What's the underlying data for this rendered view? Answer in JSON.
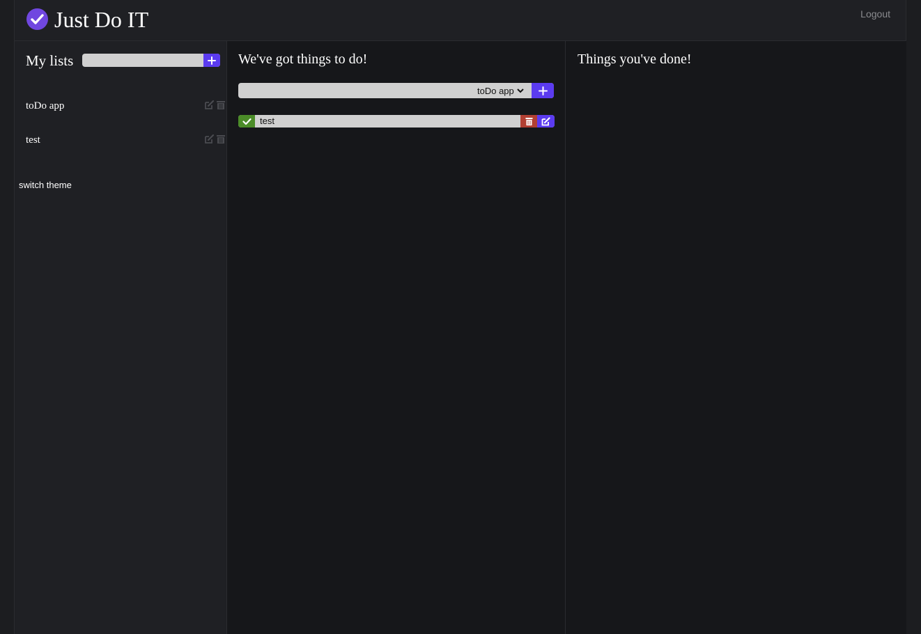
{
  "header": {
    "app_title": "Just Do IT",
    "logout_label": "Logout"
  },
  "sidebar": {
    "title": "My lists",
    "new_list_input": {
      "value": "",
      "placeholder": ""
    },
    "lists": [
      {
        "label": "toDo app"
      },
      {
        "label": "test"
      }
    ],
    "switch_theme_label": "switch theme"
  },
  "todo_column": {
    "title": "We've got things to do!",
    "new_task_input": {
      "value": "",
      "placeholder": ""
    },
    "list_select": {
      "selected": "toDo app"
    },
    "tasks": [
      {
        "text": "test"
      }
    ]
  },
  "done_column": {
    "title": "Things you've done!"
  },
  "colors": {
    "accent": "#5b3bf0",
    "logo": "#7047e0",
    "done_green": "#4b8c28",
    "delete_red": "#b24033"
  },
  "icons": {
    "logo": "check-circle-icon",
    "add": "plus-icon",
    "edit": "edit-icon",
    "delete": "trash-icon",
    "complete": "check-icon",
    "select": "chevron-down-icon"
  }
}
